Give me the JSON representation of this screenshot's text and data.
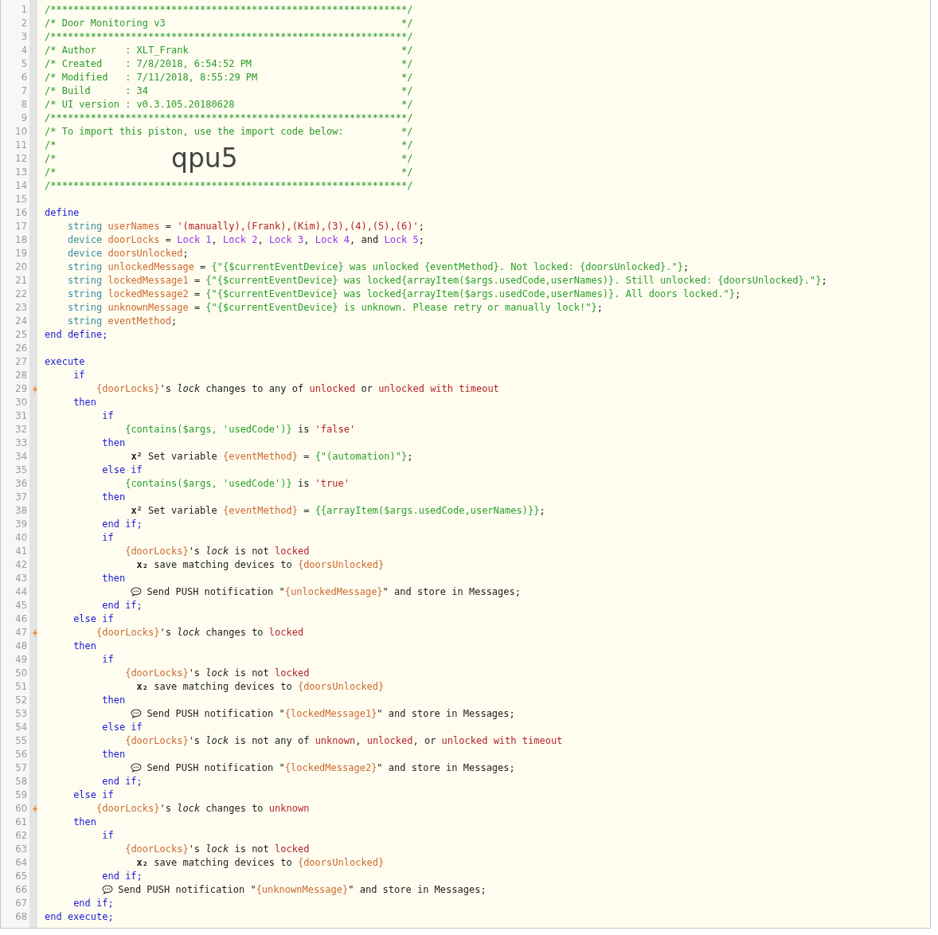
{
  "lines": [
    {
      "number": "1",
      "trigger": false,
      "tokens": [
        {
          "kind": "comment",
          "text": "/**************************************************************/"
        }
      ]
    },
    {
      "number": "2",
      "trigger": false,
      "tokens": [
        {
          "kind": "comment",
          "text": "/* Door Monitoring v3                                         */"
        }
      ]
    },
    {
      "number": "3",
      "trigger": false,
      "tokens": [
        {
          "kind": "comment",
          "text": "/**************************************************************/"
        }
      ]
    },
    {
      "number": "4",
      "trigger": false,
      "tokens": [
        {
          "kind": "comment",
          "text": "/* Author     : XLT_Frank                                     */"
        }
      ]
    },
    {
      "number": "5",
      "trigger": false,
      "tokens": [
        {
          "kind": "comment",
          "text": "/* Created    : 7/8/2018, 6:54:52 PM                          */"
        }
      ]
    },
    {
      "number": "6",
      "trigger": false,
      "tokens": [
        {
          "kind": "comment",
          "text": "/* Modified   : 7/11/2018, 8:55:29 PM                         */"
        }
      ]
    },
    {
      "number": "7",
      "trigger": false,
      "tokens": [
        {
          "kind": "comment",
          "text": "/* Build      : 34                                            */"
        }
      ]
    },
    {
      "number": "8",
      "trigger": false,
      "tokens": [
        {
          "kind": "comment",
          "text": "/* UI version : v0.3.105.20180628                             */"
        }
      ]
    },
    {
      "number": "9",
      "trigger": false,
      "tokens": [
        {
          "kind": "comment",
          "text": "/**************************************************************/"
        }
      ]
    },
    {
      "number": "10",
      "trigger": false,
      "tokens": [
        {
          "kind": "comment",
          "text": "/* To import this piston, use the import code below:          */"
        }
      ]
    },
    {
      "number": "11",
      "trigger": false,
      "tokens": [
        {
          "kind": "comment",
          "text": "/*"
        },
        {
          "kind": "comment",
          "text": "                                                            */"
        }
      ]
    },
    {
      "number": "12",
      "trigger": false,
      "tokens": [
        {
          "kind": "comment",
          "text": "/*"
        },
        {
          "kind": "import-code",
          "text": "                    qpu5"
        },
        {
          "kind": "comment",
          "text": "*/"
        }
      ]
    },
    {
      "number": "13",
      "trigger": false,
      "tokens": [
        {
          "kind": "comment",
          "text": "/*"
        },
        {
          "kind": "comment",
          "text": "                                                            */"
        }
      ]
    },
    {
      "number": "14",
      "trigger": false,
      "tokens": [
        {
          "kind": "comment",
          "text": "/**************************************************************/"
        }
      ]
    },
    {
      "number": "15",
      "trigger": false
    },
    {
      "number": "16",
      "trigger": false,
      "tokens": [
        {
          "kind": "keyword",
          "text": "define"
        }
      ]
    },
    {
      "number": "17",
      "trigger": false,
      "tokens": [
        {
          "kind": "type",
          "text": "    string "
        },
        {
          "kind": "variable",
          "text": "userNames"
        },
        {
          "kind": "plain",
          "text": " = "
        },
        {
          "kind": "string",
          "text": "'(manually),(Frank),(Kim),(3),(4),(5),(6)'"
        },
        {
          "kind": "plain",
          "text": ";"
        }
      ]
    },
    {
      "number": "18",
      "trigger": false,
      "tokens": [
        {
          "kind": "type",
          "text": "    device "
        },
        {
          "kind": "variable",
          "text": "doorLocks"
        },
        {
          "kind": "plain",
          "text": " = "
        },
        {
          "kind": "device",
          "text": "Lock 1"
        },
        {
          "kind": "plain",
          "text": ", "
        },
        {
          "kind": "device",
          "text": "Lock 2"
        },
        {
          "kind": "plain",
          "text": ", "
        },
        {
          "kind": "device",
          "text": "Lock 3"
        },
        {
          "kind": "plain",
          "text": ", "
        },
        {
          "kind": "device",
          "text": "Lock 4"
        },
        {
          "kind": "plain",
          "text": ", and "
        },
        {
          "kind": "device",
          "text": "Lock 5"
        },
        {
          "kind": "plain",
          "text": ";"
        }
      ]
    },
    {
      "number": "19",
      "trigger": false,
      "tokens": [
        {
          "kind": "type",
          "text": "    device "
        },
        {
          "kind": "variable",
          "text": "doorsUnlocked"
        },
        {
          "kind": "plain",
          "text": ";"
        }
      ]
    },
    {
      "number": "20",
      "trigger": false,
      "tokens": [
        {
          "kind": "type",
          "text": "    string "
        },
        {
          "kind": "variable",
          "text": "unlockedMessage"
        },
        {
          "kind": "plain",
          "text": " = "
        },
        {
          "kind": "expression",
          "text": "{\"{$currentEventDevice} was unlocked {eventMethod}. Not locked: {doorsUnlocked}.\"}"
        },
        {
          "kind": "plain",
          "text": ";"
        }
      ]
    },
    {
      "number": "21",
      "trigger": false,
      "tokens": [
        {
          "kind": "type",
          "text": "    string "
        },
        {
          "kind": "variable",
          "text": "lockedMessage1"
        },
        {
          "kind": "plain",
          "text": " = "
        },
        {
          "kind": "expression",
          "text": "{\"{$currentEventDevice} was locked{arrayItem($args.usedCode,userNames)}. Still unlocked: {doorsUnlocked}.\"}"
        },
        {
          "kind": "plain",
          "text": ";"
        }
      ]
    },
    {
      "number": "22",
      "trigger": false,
      "tokens": [
        {
          "kind": "type",
          "text": "    string "
        },
        {
          "kind": "variable",
          "text": "lockedMessage2"
        },
        {
          "kind": "plain",
          "text": " = "
        },
        {
          "kind": "expression",
          "text": "{\"{$currentEventDevice} was locked{arrayItem($args.usedCode,userNames)}. All doors locked.\"}"
        },
        {
          "kind": "plain",
          "text": ";"
        }
      ]
    },
    {
      "number": "23",
      "trigger": false,
      "tokens": [
        {
          "kind": "type",
          "text": "    string "
        },
        {
          "kind": "variable",
          "text": "unknownMessage"
        },
        {
          "kind": "plain",
          "text": " = "
        },
        {
          "kind": "expression",
          "text": "{\"{$currentEventDevice} is unknown. Please retry or manually lock!\"}"
        },
        {
          "kind": "plain",
          "text": ";"
        }
      ]
    },
    {
      "number": "24",
      "trigger": false,
      "tokens": [
        {
          "kind": "type",
          "text": "    string "
        },
        {
          "kind": "variable",
          "text": "eventMethod"
        },
        {
          "kind": "plain",
          "text": ";"
        }
      ]
    },
    {
      "number": "25",
      "trigger": false,
      "tokens": [
        {
          "kind": "keyword",
          "text": "end define;"
        }
      ]
    },
    {
      "number": "26",
      "trigger": false
    },
    {
      "number": "27",
      "trigger": false,
      "tokens": [
        {
          "kind": "keyword",
          "text": "execute"
        }
      ]
    },
    {
      "number": "28",
      "trigger": false,
      "tokens": [
        {
          "kind": "keyword",
          "text": "     if"
        }
      ]
    },
    {
      "number": "29",
      "trigger": true,
      "tokens": [
        {
          "kind": "variable",
          "text": "         {doorLocks}"
        },
        {
          "kind": "plain",
          "text": "'s "
        },
        {
          "kind": "attribute",
          "text": "lock"
        },
        {
          "kind": "plain",
          "text": " changes to any of "
        },
        {
          "kind": "value",
          "text": "unlocked"
        },
        {
          "kind": "plain",
          "text": " or "
        },
        {
          "kind": "value",
          "text": "unlocked with timeout"
        }
      ]
    },
    {
      "number": "30",
      "trigger": false,
      "tokens": [
        {
          "kind": "keyword",
          "text": "     then"
        }
      ]
    },
    {
      "number": "31",
      "trigger": false,
      "tokens": [
        {
          "kind": "keyword",
          "text": "          if"
        }
      ]
    },
    {
      "number": "32",
      "trigger": false,
      "tokens": [
        {
          "kind": "expression",
          "text": "              {contains($args, 'usedCode')}"
        },
        {
          "kind": "plain",
          "text": " is "
        },
        {
          "kind": "string",
          "text": "'false'"
        }
      ]
    },
    {
      "number": "33",
      "trigger": false,
      "tokens": [
        {
          "kind": "keyword",
          "text": "          then"
        }
      ]
    },
    {
      "number": "34",
      "trigger": false,
      "tokens": [
        {
          "kind": "operator",
          "text": "               x²"
        },
        {
          "kind": "plain",
          "text": " Set variable "
        },
        {
          "kind": "variable",
          "text": "{eventMethod}"
        },
        {
          "kind": "plain",
          "text": " = "
        },
        {
          "kind": "expression",
          "text": "{\"(automation)\"}"
        },
        {
          "kind": "plain",
          "text": ";"
        }
      ]
    },
    {
      "number": "35",
      "trigger": false,
      "tokens": [
        {
          "kind": "keyword",
          "text": "          else if"
        }
      ]
    },
    {
      "number": "36",
      "trigger": false,
      "tokens": [
        {
          "kind": "expression",
          "text": "              {contains($args, 'usedCode')}"
        },
        {
          "kind": "plain",
          "text": " is "
        },
        {
          "kind": "string",
          "text": "'true'"
        }
      ]
    },
    {
      "number": "37",
      "trigger": false,
      "tokens": [
        {
          "kind": "keyword",
          "text": "          then"
        }
      ]
    },
    {
      "number": "38",
      "trigger": false,
      "tokens": [
        {
          "kind": "operator",
          "text": "               x²"
        },
        {
          "kind": "plain",
          "text": " Set variable "
        },
        {
          "kind": "variable",
          "text": "{eventMethod}"
        },
        {
          "kind": "plain",
          "text": " = "
        },
        {
          "kind": "expression",
          "text": "{{arrayItem($args.usedCode,userNames)}}"
        },
        {
          "kind": "plain",
          "text": ";"
        }
      ]
    },
    {
      "number": "39",
      "trigger": false,
      "tokens": [
        {
          "kind": "keyword",
          "text": "          end if;"
        }
      ]
    },
    {
      "number": "40",
      "trigger": false,
      "tokens": [
        {
          "kind": "keyword",
          "text": "          if"
        }
      ]
    },
    {
      "number": "41",
      "trigger": false,
      "tokens": [
        {
          "kind": "variable",
          "text": "              {doorLocks}"
        },
        {
          "kind": "plain",
          "text": "'s "
        },
        {
          "kind": "attribute",
          "text": "lock"
        },
        {
          "kind": "plain",
          "text": " is not "
        },
        {
          "kind": "value",
          "text": "locked"
        }
      ]
    },
    {
      "number": "42",
      "trigger": false,
      "tokens": [
        {
          "kind": "operator",
          "text": "                x₂"
        },
        {
          "kind": "plain",
          "text": " save matching devices to "
        },
        {
          "kind": "variable",
          "text": "{doorsUnlocked}"
        }
      ]
    },
    {
      "number": "43",
      "trigger": false,
      "tokens": [
        {
          "kind": "keyword",
          "text": "          then"
        }
      ]
    },
    {
      "number": "44",
      "trigger": false,
      "tokens": [
        {
          "kind": "plain",
          "message_icon": true,
          "text": "               Send PUSH notification \""
        },
        {
          "kind": "variable",
          "text": "{unlockedMessage}"
        },
        {
          "kind": "plain",
          "text": "\" and store in Messages;"
        }
      ]
    },
    {
      "number": "45",
      "trigger": false,
      "tokens": [
        {
          "kind": "keyword",
          "text": "          end if;"
        }
      ]
    },
    {
      "number": "46",
      "trigger": false,
      "tokens": [
        {
          "kind": "keyword",
          "text": "     else if"
        }
      ]
    },
    {
      "number": "47",
      "trigger": true,
      "tokens": [
        {
          "kind": "variable",
          "text": "         {doorLocks}"
        },
        {
          "kind": "plain",
          "text": "'s "
        },
        {
          "kind": "attribute",
          "text": "lock"
        },
        {
          "kind": "plain",
          "text": " changes to "
        },
        {
          "kind": "value",
          "text": "locked"
        }
      ]
    },
    {
      "number": "48",
      "trigger": false,
      "tokens": [
        {
          "kind": "keyword",
          "text": "     then"
        }
      ]
    },
    {
      "number": "49",
      "trigger": false,
      "tokens": [
        {
          "kind": "keyword",
          "text": "          if"
        }
      ]
    },
    {
      "number": "50",
      "trigger": false,
      "tokens": [
        {
          "kind": "variable",
          "text": "              {doorLocks}"
        },
        {
          "kind": "plain",
          "text": "'s "
        },
        {
          "kind": "attribute",
          "text": "lock"
        },
        {
          "kind": "plain",
          "text": " is not "
        },
        {
          "kind": "value",
          "text": "locked"
        }
      ]
    },
    {
      "number": "51",
      "trigger": false,
      "tokens": [
        {
          "kind": "operator",
          "text": "                x₂"
        },
        {
          "kind": "plain",
          "text": " save matching devices to "
        },
        {
          "kind": "variable",
          "text": "{doorsUnlocked}"
        }
      ]
    },
    {
      "number": "52",
      "trigger": false,
      "tokens": [
        {
          "kind": "keyword",
          "text": "          then"
        }
      ]
    },
    {
      "number": "53",
      "trigger": false,
      "tokens": [
        {
          "kind": "plain",
          "message_icon": true,
          "text": "               Send PUSH notification \""
        },
        {
          "kind": "variable",
          "text": "{lockedMessage1}"
        },
        {
          "kind": "plain",
          "text": "\" and store in Messages;"
        }
      ]
    },
    {
      "number": "54",
      "trigger": false,
      "tokens": [
        {
          "kind": "keyword",
          "text": "          else if"
        }
      ]
    },
    {
      "number": "55",
      "trigger": false,
      "tokens": [
        {
          "kind": "variable",
          "text": "              {doorLocks}"
        },
        {
          "kind": "plain",
          "text": "'s "
        },
        {
          "kind": "attribute",
          "text": "lock"
        },
        {
          "kind": "plain",
          "text": " is not any of "
        },
        {
          "kind": "value",
          "text": "unknown"
        },
        {
          "kind": "plain",
          "text": ", "
        },
        {
          "kind": "value",
          "text": "unlocked"
        },
        {
          "kind": "plain",
          "text": ", or "
        },
        {
          "kind": "value",
          "text": "unlocked with timeout"
        }
      ]
    },
    {
      "number": "56",
      "trigger": false,
      "tokens": [
        {
          "kind": "keyword",
          "text": "          then"
        }
      ]
    },
    {
      "number": "57",
      "trigger": false,
      "tokens": [
        {
          "kind": "plain",
          "message_icon": true,
          "text": "               Send PUSH notification \""
        },
        {
          "kind": "variable",
          "text": "{lockedMessage2}"
        },
        {
          "kind": "plain",
          "text": "\" and store in Messages;"
        }
      ]
    },
    {
      "number": "58",
      "trigger": false,
      "tokens": [
        {
          "kind": "keyword",
          "text": "          end if;"
        }
      ]
    },
    {
      "number": "59",
      "trigger": false,
      "tokens": [
        {
          "kind": "keyword",
          "text": "     else if"
        }
      ]
    },
    {
      "number": "60",
      "trigger": true,
      "tokens": [
        {
          "kind": "variable",
          "text": "         {doorLocks}"
        },
        {
          "kind": "plain",
          "text": "'s "
        },
        {
          "kind": "attribute",
          "text": "lock"
        },
        {
          "kind": "plain",
          "text": " changes to "
        },
        {
          "kind": "value",
          "text": "unknown"
        }
      ]
    },
    {
      "number": "61",
      "trigger": false,
      "tokens": [
        {
          "kind": "keyword",
          "text": "     then"
        }
      ]
    },
    {
      "number": "62",
      "trigger": false,
      "tokens": [
        {
          "kind": "keyword",
          "text": "          if"
        }
      ]
    },
    {
      "number": "63",
      "trigger": false,
      "tokens": [
        {
          "kind": "variable",
          "text": "              {doorLocks}"
        },
        {
          "kind": "plain",
          "text": "'s "
        },
        {
          "kind": "attribute",
          "text": "lock"
        },
        {
          "kind": "plain",
          "text": " is not "
        },
        {
          "kind": "value",
          "text": "locked"
        }
      ]
    },
    {
      "number": "64",
      "trigger": false,
      "tokens": [
        {
          "kind": "operator",
          "text": "                x₂"
        },
        {
          "kind": "plain",
          "text": " save matching devices to "
        },
        {
          "kind": "variable",
          "text": "{doorsUnlocked}"
        }
      ]
    },
    {
      "number": "65",
      "trigger": false,
      "tokens": [
        {
          "kind": "keyword",
          "text": "          end if;"
        }
      ]
    },
    {
      "number": "66",
      "trigger": false,
      "tokens": [
        {
          "kind": "plain",
          "message_icon": true,
          "text": "          Send PUSH notification \""
        },
        {
          "kind": "variable",
          "text": "{unknownMessage}"
        },
        {
          "kind": "plain",
          "text": "\" and store in Messages;"
        }
      ]
    },
    {
      "number": "67",
      "trigger": false,
      "tokens": [
        {
          "kind": "keyword",
          "text": "     end if;"
        }
      ]
    },
    {
      "number": "68",
      "trigger": false,
      "tokens": [
        {
          "kind": "keyword",
          "text": "end execute;"
        }
      ]
    }
  ]
}
